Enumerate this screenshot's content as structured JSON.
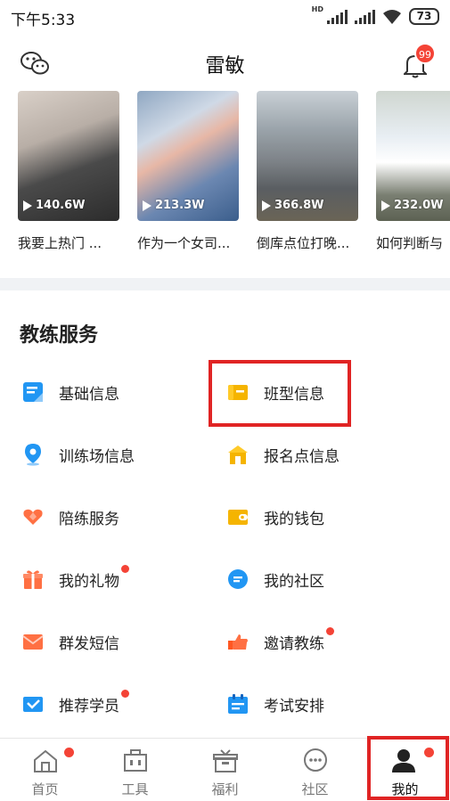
{
  "status_bar": {
    "time": "下午5:33",
    "network_tag": "HD",
    "battery": "73"
  },
  "header": {
    "title": "雷敏",
    "notification_count": "99"
  },
  "videos": [
    {
      "views": "140.6W",
      "caption": "我要上热门 ..."
    },
    {
      "views": "213.3W",
      "caption": "作为一个女司..."
    },
    {
      "views": "366.8W",
      "caption": "倒库点位打晚..."
    },
    {
      "views": "232.0W",
      "caption": "如何判断与"
    }
  ],
  "coach_services": {
    "title": "教练服务",
    "items": [
      {
        "label": "基础信息",
        "icon": "profile-doc-icon",
        "color": "#2196f3",
        "dot": false
      },
      {
        "label": "班型信息",
        "icon": "class-card-icon",
        "color": "#f5b400",
        "dot": false
      },
      {
        "label": "训练场信息",
        "icon": "location-pin-icon",
        "color": "#2196f3",
        "dot": false
      },
      {
        "label": "报名点信息",
        "icon": "house-icon",
        "color": "#f5b400",
        "dot": false
      },
      {
        "label": "陪练服务",
        "icon": "heart-hands-icon",
        "color": "#ff7043",
        "dot": false
      },
      {
        "label": "我的钱包",
        "icon": "wallet-icon",
        "color": "#f5b400",
        "dot": false
      },
      {
        "label": "我的礼物",
        "icon": "gift-icon",
        "color": "#ff7043",
        "dot": true
      },
      {
        "label": "我的社区",
        "icon": "chat-bubble-icon",
        "color": "#2196f3",
        "dot": false
      },
      {
        "label": "群发短信",
        "icon": "envelope-icon",
        "color": "#ff7043",
        "dot": false
      },
      {
        "label": "邀请教练",
        "icon": "thumbs-hand-icon",
        "color": "#ff7043",
        "dot": true
      },
      {
        "label": "推荐学员",
        "icon": "mail-check-icon",
        "color": "#2196f3",
        "dot": true
      },
      {
        "label": "考试安排",
        "icon": "calendar-icon",
        "color": "#2196f3",
        "dot": false
      }
    ]
  },
  "tab_bar": {
    "tabs": [
      {
        "label": "首页",
        "icon": "home-icon",
        "dot": true,
        "active": false
      },
      {
        "label": "工具",
        "icon": "toolbox-icon",
        "dot": false,
        "active": false
      },
      {
        "label": "福利",
        "icon": "gift-box-icon",
        "dot": false,
        "active": false
      },
      {
        "label": "社区",
        "icon": "chat-icon",
        "dot": false,
        "active": false
      },
      {
        "label": "我的",
        "icon": "person-icon",
        "dot": true,
        "active": true
      }
    ]
  },
  "colors": {
    "accent_red": "#e02424",
    "badge_red": "#f44336",
    "section_bg": "#f0f2f5"
  }
}
